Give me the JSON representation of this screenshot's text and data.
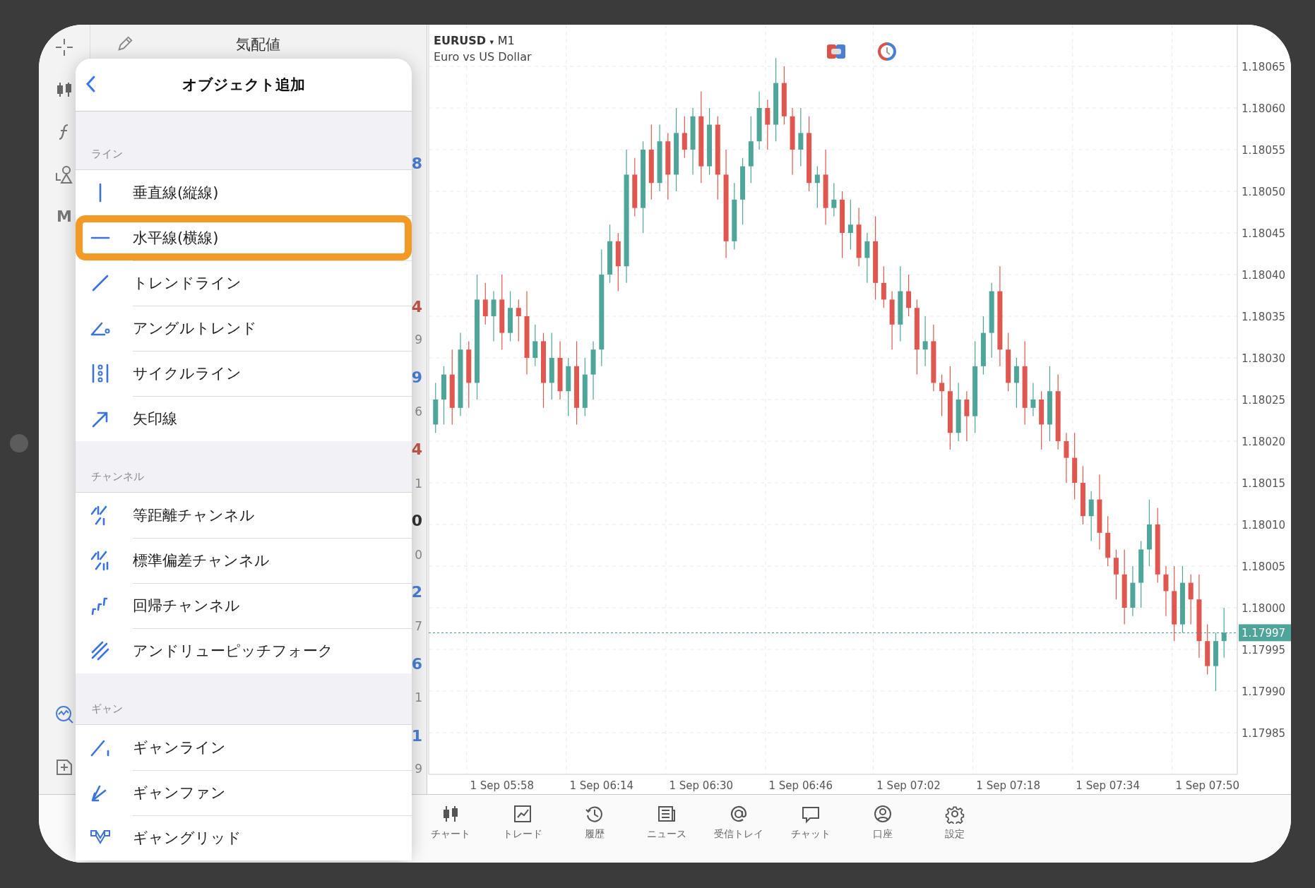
{
  "toolbar": {
    "items": [
      {
        "kind": "crosshair"
      },
      {
        "kind": "candles"
      },
      {
        "kind": "function"
      },
      {
        "kind": "shapes"
      },
      {
        "kind": "letter",
        "label": "M"
      },
      {
        "kind": "chart-search"
      },
      {
        "kind": "add-doc"
      }
    ]
  },
  "watchlist": {
    "title": "気配値",
    "fragments": [
      {
        "text": "8",
        "color": "#4a7fd4",
        "kind": "big"
      },
      {
        "text": "4",
        "color": "#c0574e",
        "kind": "big"
      },
      {
        "text": "9",
        "color": "#8a8a8a",
        "kind": "small"
      },
      {
        "text": "9",
        "color": "#4a7fd4",
        "kind": "big"
      },
      {
        "text": "6",
        "color": "#8a8a8a",
        "kind": "small"
      },
      {
        "text": "4",
        "color": "#c0574e",
        "kind": "big"
      },
      {
        "text": "1",
        "color": "#8a8a8a",
        "kind": "small"
      },
      {
        "text": "0",
        "color": "#333333",
        "kind": "big"
      },
      {
        "text": "0",
        "color": "#8a8a8a",
        "kind": "small"
      },
      {
        "text": "2",
        "color": "#4a7fd4",
        "kind": "big"
      },
      {
        "text": "7",
        "color": "#8a8a8a",
        "kind": "small"
      },
      {
        "text": "6",
        "color": "#4a7fd4",
        "kind": "big"
      },
      {
        "text": "1",
        "color": "#8a8a8a",
        "kind": "small"
      },
      {
        "text": "1",
        "color": "#4a7fd4",
        "kind": "big"
      },
      {
        "text": "9",
        "color": "#8a8a8a",
        "kind": "small"
      }
    ]
  },
  "popup": {
    "title": "オブジェクト追加",
    "sections": [
      {
        "label": "ライン",
        "items": [
          {
            "label": "垂直線(縦線)",
            "kind": "vertical",
            "highlighted": false
          },
          {
            "label": "水平線(横線)",
            "kind": "horizontal",
            "highlighted": true
          },
          {
            "label": "トレンドライン",
            "kind": "trend",
            "highlighted": false
          },
          {
            "label": "アングルトレンド",
            "kind": "angle",
            "highlighted": false
          },
          {
            "label": "サイクルライン",
            "kind": "cycle",
            "highlighted": false
          },
          {
            "label": "矢印線",
            "kind": "arrow",
            "highlighted": false
          }
        ]
      },
      {
        "label": "チャンネル",
        "items": [
          {
            "label": "等距離チャンネル",
            "kind": "equidistant",
            "highlighted": false
          },
          {
            "label": "標準偏差チャンネル",
            "kind": "stddev",
            "highlighted": false
          },
          {
            "label": "回帰チャンネル",
            "kind": "regression",
            "highlighted": false
          },
          {
            "label": "アンドリューピッチフォーク",
            "kind": "pitchfork",
            "highlighted": false
          }
        ]
      },
      {
        "label": "ギャン",
        "items": [
          {
            "label": "ギャンライン",
            "kind": "gannline",
            "highlighted": false
          },
          {
            "label": "ギャンファン",
            "kind": "gannfan",
            "highlighted": false
          },
          {
            "label": "ギャングリッド",
            "kind": "ganngrid",
            "highlighted": false
          }
        ]
      }
    ]
  },
  "chart": {
    "symbol": "EURUSD",
    "symbol_caret": "▾",
    "timeframe": "M1",
    "description": "Euro vs US Dollar",
    "chart_data": {
      "type": "candlestick",
      "categories": [
        null,
        null,
        null,
        null,
        null,
        null,
        null,
        null,
        "1 Sep 05:58",
        null,
        null,
        null,
        null,
        null,
        null,
        null,
        null,
        null,
        null,
        null,
        "1 Sep 06:14",
        null,
        null,
        null,
        null,
        null,
        null,
        null,
        null,
        null,
        null,
        null,
        "1 Sep 06:30",
        null,
        null,
        null,
        null,
        null,
        null,
        null,
        null,
        null,
        null,
        null,
        "1 Sep 06:46",
        null,
        null,
        null,
        null,
        null,
        null,
        null,
        null,
        null,
        null,
        null,
        null,
        "1 Sep 07:02",
        null,
        null,
        null,
        null,
        null,
        null,
        null,
        null,
        null,
        null,
        null,
        "1 Sep 07:18",
        null,
        null,
        null,
        null,
        null,
        null,
        null,
        null,
        null,
        null,
        null,
        "1 Sep 07:34",
        null,
        null,
        null,
        null,
        null,
        null,
        null,
        null,
        null,
        null,
        null,
        "1 Sep 07:50",
        null,
        null
      ],
      "ohlc": [
        [
          1.18022,
          1.18027,
          1.18021,
          1.18025
        ],
        [
          1.18025,
          1.18029,
          1.18022,
          1.18028
        ],
        [
          1.18028,
          1.18031,
          1.18022,
          1.18024
        ],
        [
          1.18024,
          1.18033,
          1.18023,
          1.18031
        ],
        [
          1.18031,
          1.18032,
          1.18024,
          1.18027
        ],
        [
          1.18027,
          1.1804,
          1.18025,
          1.18037
        ],
        [
          1.18037,
          1.18039,
          1.18034,
          1.18035
        ],
        [
          1.18035,
          1.18038,
          1.18032,
          1.18037
        ],
        [
          1.18037,
          1.1804,
          1.18031,
          1.18033
        ],
        [
          1.18033,
          1.18038,
          1.18032,
          1.18036
        ],
        [
          1.18036,
          1.18037,
          1.18032,
          1.18035
        ],
        [
          1.18035,
          1.18038,
          1.18028,
          1.1803
        ],
        [
          1.1803,
          1.18034,
          1.18029,
          1.18032
        ],
        [
          1.18032,
          1.18033,
          1.18024,
          1.18027
        ],
        [
          1.18027,
          1.18033,
          1.18025,
          1.1803
        ],
        [
          1.1803,
          1.18032,
          1.18025,
          1.18026
        ],
        [
          1.18026,
          1.1803,
          1.18023,
          1.18029
        ],
        [
          1.18029,
          1.18032,
          1.18022,
          1.18024
        ],
        [
          1.18024,
          1.1803,
          1.18023,
          1.18028
        ],
        [
          1.18028,
          1.18032,
          1.18025,
          1.18031
        ],
        [
          1.18031,
          1.18043,
          1.18029,
          1.1804
        ],
        [
          1.1804,
          1.18046,
          1.18039,
          1.18044
        ],
        [
          1.18044,
          1.18045,
          1.18038,
          1.18041
        ],
        [
          1.18041,
          1.18055,
          1.18039,
          1.18052
        ],
        [
          1.18052,
          1.18054,
          1.18047,
          1.18048
        ],
        [
          1.18048,
          1.18056,
          1.18045,
          1.18055
        ],
        [
          1.18055,
          1.18058,
          1.18049,
          1.18051
        ],
        [
          1.18051,
          1.18058,
          1.1805,
          1.18056
        ],
        [
          1.18056,
          1.18057,
          1.18049,
          1.18052
        ],
        [
          1.18052,
          1.1806,
          1.1805,
          1.18057
        ],
        [
          1.18057,
          1.18059,
          1.18054,
          1.18055
        ],
        [
          1.18055,
          1.1806,
          1.18052,
          1.18059
        ],
        [
          1.18059,
          1.18062,
          1.18051,
          1.18053
        ],
        [
          1.18053,
          1.1806,
          1.18052,
          1.18058
        ],
        [
          1.18058,
          1.18059,
          1.18049,
          1.18052
        ],
        [
          1.18052,
          1.18055,
          1.18042,
          1.18044
        ],
        [
          1.18044,
          1.18051,
          1.18043,
          1.18049
        ],
        [
          1.18049,
          1.18054,
          1.18046,
          1.18053
        ],
        [
          1.18053,
          1.18059,
          1.18051,
          1.18056
        ],
        [
          1.18056,
          1.18062,
          1.18055,
          1.1806
        ],
        [
          1.1806,
          1.18061,
          1.18055,
          1.18058
        ],
        [
          1.18058,
          1.18066,
          1.18056,
          1.18063
        ],
        [
          1.18063,
          1.18065,
          1.18058,
          1.18059
        ],
        [
          1.18059,
          1.1806,
          1.18052,
          1.18055
        ],
        [
          1.18055,
          1.1806,
          1.18053,
          1.18057
        ],
        [
          1.18057,
          1.18059,
          1.1805,
          1.18051
        ],
        [
          1.18051,
          1.18053,
          1.18048,
          1.18052
        ],
        [
          1.18052,
          1.18055,
          1.18046,
          1.18048
        ],
        [
          1.18048,
          1.18051,
          1.18047,
          1.18049
        ],
        [
          1.18049,
          1.1805,
          1.18042,
          1.18045
        ],
        [
          1.18045,
          1.18049,
          1.18043,
          1.18046
        ],
        [
          1.18046,
          1.18048,
          1.18041,
          1.18042
        ],
        [
          1.18042,
          1.18045,
          1.18039,
          1.18044
        ],
        [
          1.18044,
          1.18047,
          1.18037,
          1.18039
        ],
        [
          1.18039,
          1.18041,
          1.18036,
          1.18037
        ],
        [
          1.18037,
          1.18038,
          1.18031,
          1.18034
        ],
        [
          1.18034,
          1.18041,
          1.18032,
          1.18038
        ],
        [
          1.18038,
          1.1804,
          1.18035,
          1.18036
        ],
        [
          1.18036,
          1.18037,
          1.18028,
          1.18031
        ],
        [
          1.18031,
          1.18035,
          1.18029,
          1.18032
        ],
        [
          1.18032,
          1.18034,
          1.18026,
          1.18027
        ],
        [
          1.18027,
          1.18028,
          1.18023,
          1.18026
        ],
        [
          1.18026,
          1.18029,
          1.18019,
          1.18021
        ],
        [
          1.18021,
          1.18027,
          1.1802,
          1.18025
        ],
        [
          1.18025,
          1.18026,
          1.1802,
          1.18023
        ],
        [
          1.18023,
          1.18032,
          1.18021,
          1.18029
        ],
        [
          1.18029,
          1.18035,
          1.18028,
          1.18033
        ],
        [
          1.18033,
          1.18039,
          1.1803,
          1.18038
        ],
        [
          1.18038,
          1.18041,
          1.18029,
          1.18031
        ],
        [
          1.18031,
          1.18033,
          1.18026,
          1.18027
        ],
        [
          1.18027,
          1.1803,
          1.18024,
          1.18029
        ],
        [
          1.18029,
          1.18032,
          1.18022,
          1.18024
        ],
        [
          1.18024,
          1.18027,
          1.18023,
          1.18025
        ],
        [
          1.18025,
          1.18026,
          1.18019,
          1.18022
        ],
        [
          1.18022,
          1.18029,
          1.1802,
          1.18026
        ],
        [
          1.18026,
          1.18028,
          1.18019,
          1.1802
        ],
        [
          1.1802,
          1.18021,
          1.18015,
          1.18018
        ],
        [
          1.18018,
          1.18021,
          1.18013,
          1.18015
        ],
        [
          1.18015,
          1.18017,
          1.1801,
          1.18011
        ],
        [
          1.18011,
          1.18014,
          1.18008,
          1.18013
        ],
        [
          1.18013,
          1.18016,
          1.18007,
          1.18009
        ],
        [
          1.18009,
          1.18011,
          1.18005,
          1.18006
        ],
        [
          1.18006,
          1.18007,
          1.18001,
          1.18004
        ],
        [
          1.18004,
          1.18007,
          1.17998,
          1.18
        ],
        [
          1.18,
          1.18005,
          1.17999,
          1.18003
        ],
        [
          1.18003,
          1.18008,
          1.18,
          1.18007
        ],
        [
          1.18007,
          1.18013,
          1.18005,
          1.1801
        ],
        [
          1.1801,
          1.18012,
          1.18003,
          1.18004
        ],
        [
          1.18004,
          1.18005,
          1.17999,
          1.18002
        ],
        [
          1.18002,
          1.18005,
          1.17996,
          1.17998
        ],
        [
          1.17998,
          1.18005,
          1.17997,
          1.18003
        ],
        [
          1.18003,
          1.18004,
          1.17998,
          1.18001
        ],
        [
          1.18001,
          1.18004,
          1.17994,
          1.17996
        ],
        [
          1.17996,
          1.17998,
          1.17992,
          1.17993
        ],
        [
          1.17993,
          1.17997,
          1.1799,
          1.17996
        ],
        [
          1.17996,
          1.18,
          1.17994,
          1.17997
        ]
      ],
      "grid": true,
      "ref_lines": [
        {
          "value": 1.17997,
          "label": "1.17997",
          "axis": "y"
        }
      ],
      "ylim": [
        1.1798,
        1.1807
      ],
      "yticks": [
        {
          "value": 1.18065,
          "label": "1.18065"
        },
        {
          "value": 1.1806,
          "label": "1.18060"
        },
        {
          "value": 1.18055,
          "label": "1.18055"
        },
        {
          "value": 1.1805,
          "label": "1.18050"
        },
        {
          "value": 1.18045,
          "label": "1.18045"
        },
        {
          "value": 1.1804,
          "label": "1.18040"
        },
        {
          "value": 1.18035,
          "label": "1.18035"
        },
        {
          "value": 1.1803,
          "label": "1.18030"
        },
        {
          "value": 1.18025,
          "label": "1.18025"
        },
        {
          "value": 1.1802,
          "label": "1.18020"
        },
        {
          "value": 1.18015,
          "label": "1.18015"
        },
        {
          "value": 1.1801,
          "label": "1.18010"
        },
        {
          "value": 1.18005,
          "label": "1.18005"
        },
        {
          "value": 1.18,
          "label": "1.18000"
        },
        {
          "value": 1.17995,
          "label": "1.17995"
        },
        {
          "value": 1.1799,
          "label": "1.17990"
        },
        {
          "value": 1.17985,
          "label": "1.17985"
        }
      ]
    }
  },
  "tabs": [
    {
      "label": "チャート",
      "kind": "candles"
    },
    {
      "label": "トレード",
      "kind": "trade"
    },
    {
      "label": "履歴",
      "kind": "history"
    },
    {
      "label": "ニュース",
      "kind": "news"
    },
    {
      "label": "受信トレイ",
      "kind": "mail"
    },
    {
      "label": "チャット",
      "kind": "chat"
    },
    {
      "label": "口座",
      "kind": "account"
    },
    {
      "label": "設定",
      "kind": "settings"
    }
  ]
}
